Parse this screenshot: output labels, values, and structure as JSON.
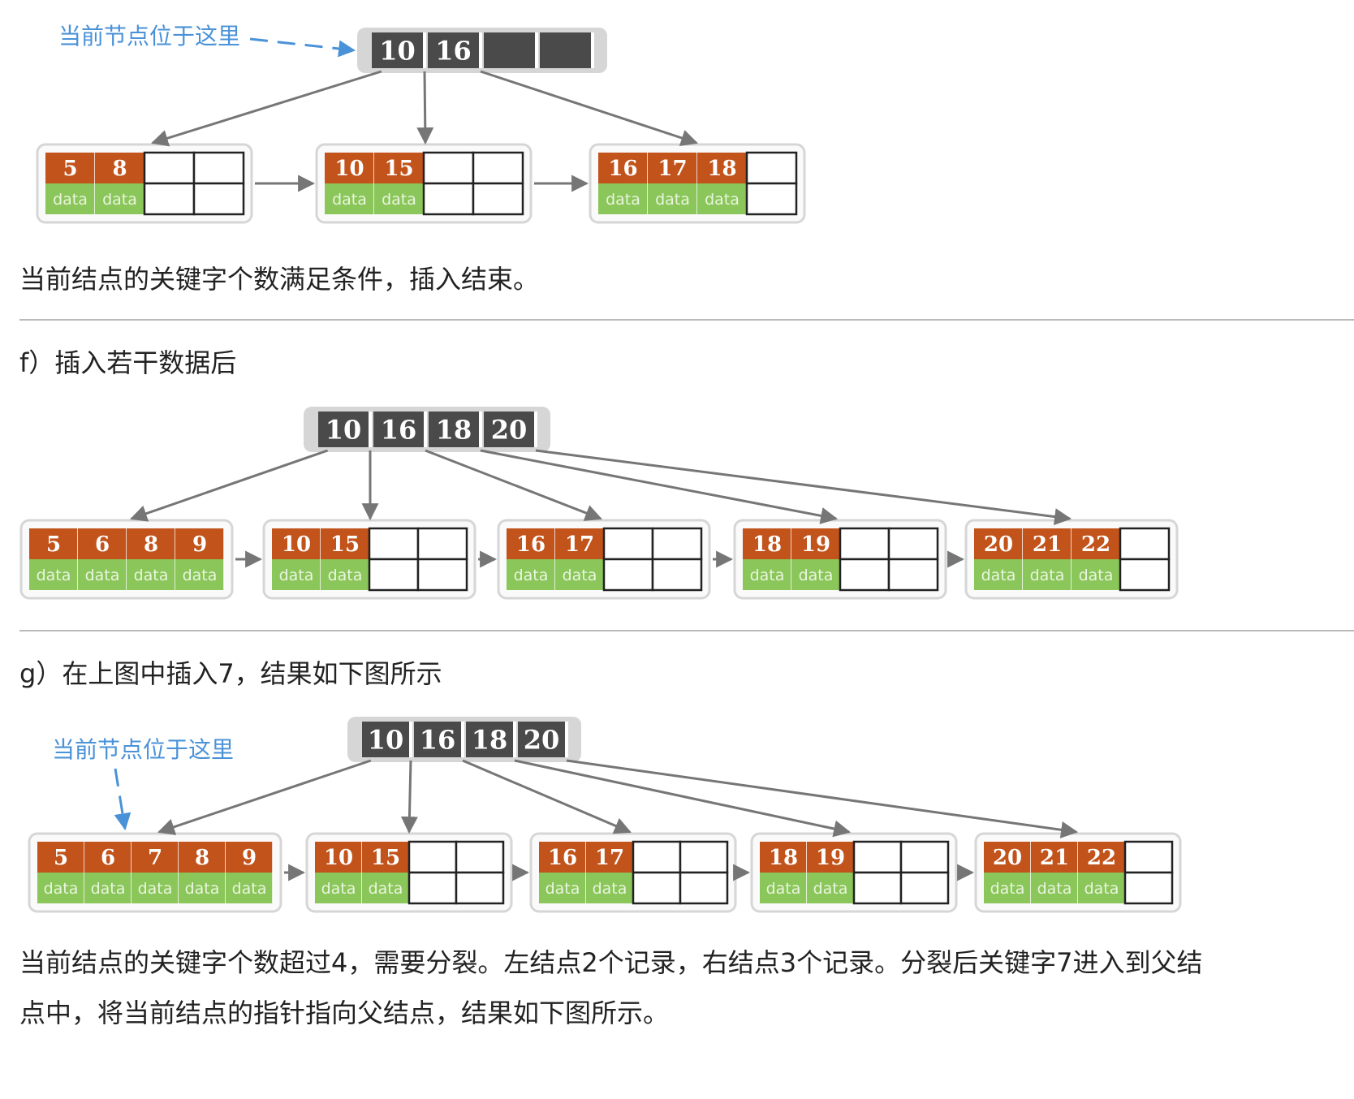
{
  "diagram_e": {
    "pointer_label": "当前节点位于这里",
    "root_keys": [
      "10",
      "16",
      "",
      ""
    ],
    "leaves": [
      {
        "keys": [
          "5",
          "8"
        ],
        "data": [
          "data",
          "data"
        ]
      },
      {
        "keys": [
          "10",
          "15"
        ],
        "data": [
          "data",
          "data"
        ]
      },
      {
        "keys": [
          "16",
          "17",
          "18"
        ],
        "data": [
          "data",
          "data",
          "data"
        ]
      }
    ]
  },
  "text_e": "当前结点的关键字个数满足条件，插入结束。",
  "heading_f": "f）插入若干数据后",
  "diagram_f": {
    "root_keys": [
      "10",
      "16",
      "18",
      "20"
    ],
    "leaves": [
      {
        "keys": [
          "5",
          "6",
          "8",
          "9"
        ],
        "data": [
          "data",
          "data",
          "data",
          "data"
        ]
      },
      {
        "keys": [
          "10",
          "15"
        ],
        "data": [
          "data",
          "data"
        ]
      },
      {
        "keys": [
          "16",
          "17"
        ],
        "data": [
          "data",
          "data"
        ]
      },
      {
        "keys": [
          "18",
          "19"
        ],
        "data": [
          "data",
          "data"
        ]
      },
      {
        "keys": [
          "20",
          "21",
          "22"
        ],
        "data": [
          "data",
          "data",
          "data"
        ]
      }
    ]
  },
  "heading_g": "g）在上图中插入7，结果如下图所示",
  "diagram_g": {
    "pointer_label": "当前节点位于这里",
    "root_keys": [
      "10",
      "16",
      "18",
      "20"
    ],
    "leaves": [
      {
        "keys": [
          "5",
          "6",
          "7",
          "8",
          "9"
        ],
        "data": [
          "data",
          "data",
          "data",
          "data",
          "data"
        ]
      },
      {
        "keys": [
          "10",
          "15"
        ],
        "data": [
          "data",
          "data"
        ]
      },
      {
        "keys": [
          "16",
          "17"
        ],
        "data": [
          "data",
          "data"
        ]
      },
      {
        "keys": [
          "18",
          "19"
        ],
        "data": [
          "data",
          "data"
        ]
      },
      {
        "keys": [
          "20",
          "21",
          "22"
        ],
        "data": [
          "data",
          "data",
          "data"
        ]
      }
    ]
  },
  "text_g_line1": "当前结点的关键字个数超过4，需要分裂。左结点2个记录，右结点3个记录。分裂后关键字7进入到父结",
  "text_g_line2": "点中，将当前结点的指针指向父结点，结果如下图所示。",
  "colors": {
    "key_cell": "#c1531b",
    "data_cell": "#8ac659",
    "root_cell": "#4a4a4a",
    "node_frame": "#d6d6d6",
    "arrow": "#767676",
    "pointer": "#4a92d8"
  }
}
